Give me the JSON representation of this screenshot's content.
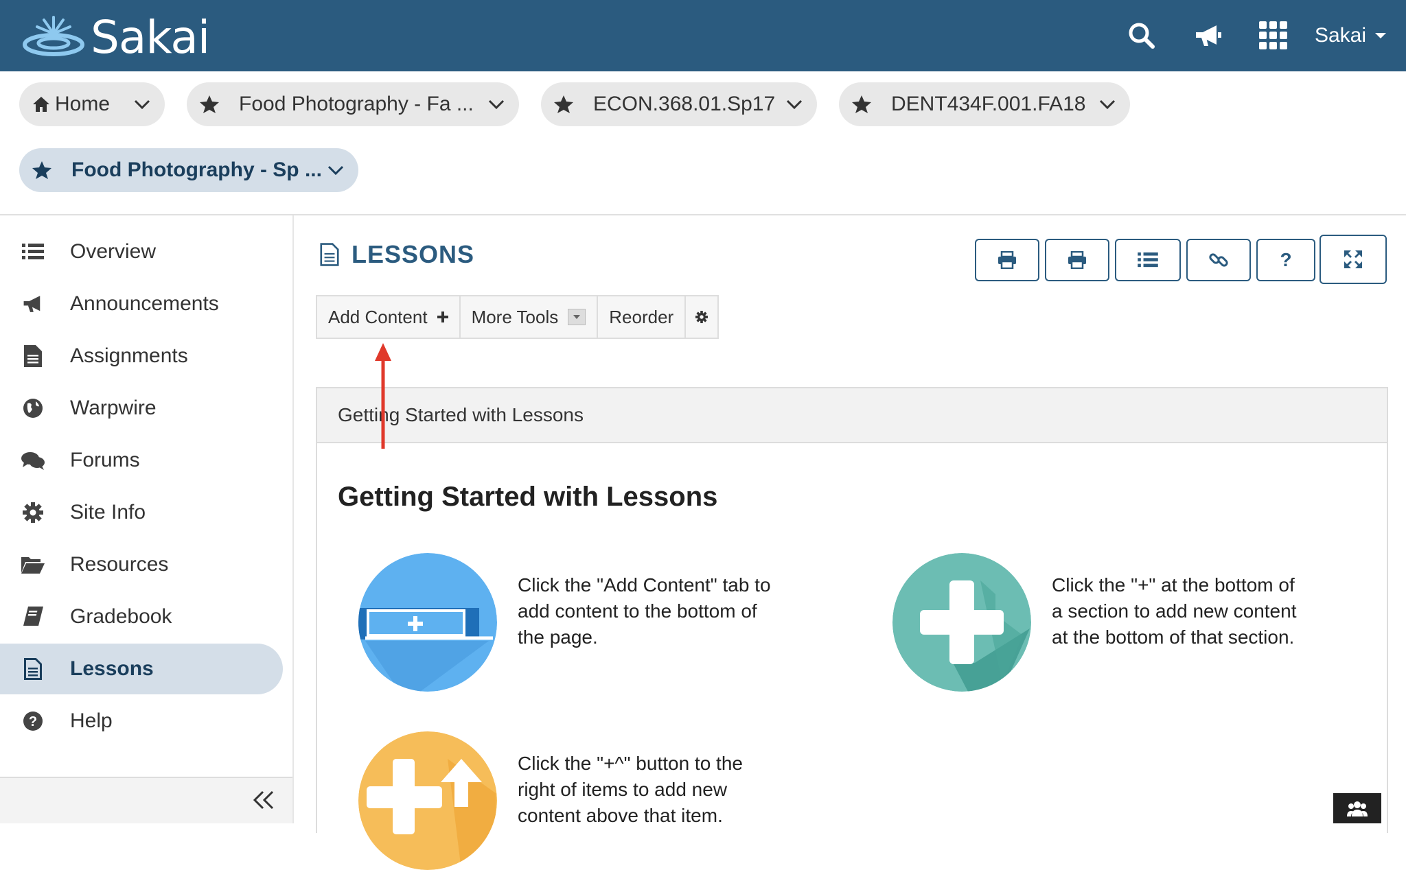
{
  "app": {
    "logo_text": "Sakai",
    "user_label": "Sakai"
  },
  "site_tabs": [
    {
      "label": "Home"
    },
    {
      "label": "Food Photography - Fa ..."
    },
    {
      "label": "ECON.368.01.Sp17"
    },
    {
      "label": "DENT434F.001.FA18"
    },
    {
      "label": "Food Photography - Sp ..."
    }
  ],
  "nav": {
    "items": [
      {
        "label": "Overview"
      },
      {
        "label": "Announcements"
      },
      {
        "label": "Assignments"
      },
      {
        "label": "Warpwire"
      },
      {
        "label": "Forums"
      },
      {
        "label": "Site Info"
      },
      {
        "label": "Resources"
      },
      {
        "label": "Gradebook"
      },
      {
        "label": "Lessons"
      },
      {
        "label": "Help"
      }
    ],
    "active": "Lessons"
  },
  "main": {
    "title": "LESSONS",
    "toolbar": {
      "add_content": "Add Content",
      "more_tools": "More Tools",
      "reorder": "Reorder"
    },
    "help_button": "?",
    "panel_header": "Getting Started with Lessons",
    "panel_title": "Getting Started with Lessons",
    "tips": [
      {
        "text": "Click the \"Add Content\" tab to add content to the bottom of the page."
      },
      {
        "text": "Click the \"+\" at the bottom of a section to add new content at the bottom of that section."
      },
      {
        "text": "Click the \"+^\" button to the right of items to add new content above that item."
      }
    ]
  },
  "colors": {
    "header_bg": "#2b5b7f",
    "active_bg": "#d4dee8",
    "annotation_arrow": "#e0392b"
  }
}
